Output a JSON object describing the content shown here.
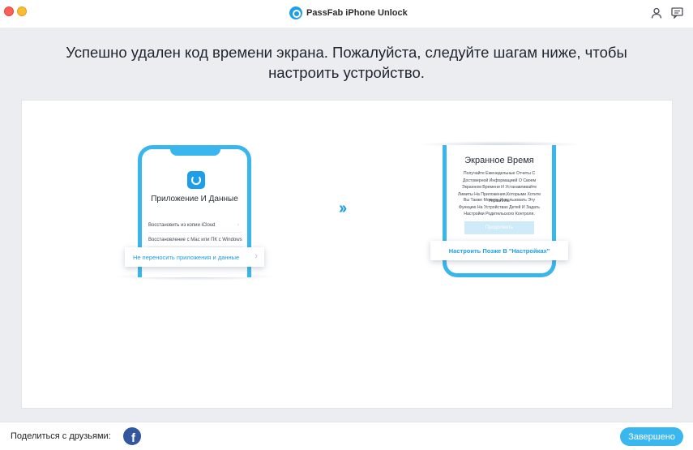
{
  "window": {
    "title": "PassFab iPhone Unlock",
    "icons": [
      "user-icon",
      "feedback-icon",
      "app-logo-icon"
    ]
  },
  "headline": {
    "line1": "Успешно удален код времени экрана. Пожалуйста, следуйте шагам ниже, чтобы",
    "line2": "настроить устройство."
  },
  "step1": {
    "screen_title": "Приложение И Данные",
    "option1": "Восстановить из копии iCloud",
    "option2": "Восстановление с Mac или ПК с Windows",
    "callout": "Не переносить приложения и данные"
  },
  "step2": {
    "screen_title": "Экранное Время",
    "text1": "Получайте Еженедельные Отчеты С Достоверной Информацией О Своем Экранном Времени И Устанавливайте Лимиты На Приложения,Которыми Хотите Управлять.",
    "text2": "Вы Также Можете Использовать Эту Функцию На Устройствах Детей И Задать Настройки Родительского Контроля.",
    "continue_label": "Продолжить",
    "callout": "Настроить Позже В \"Настройках\""
  },
  "footer": {
    "share_label": "Поделиться с друзьями:",
    "finish_label": "Завершено"
  },
  "colors": {
    "accent": "#1e9ee8",
    "phone_frame": "#3ab6ee",
    "finish_button": "#3ab7ef",
    "facebook": "#33579e"
  }
}
